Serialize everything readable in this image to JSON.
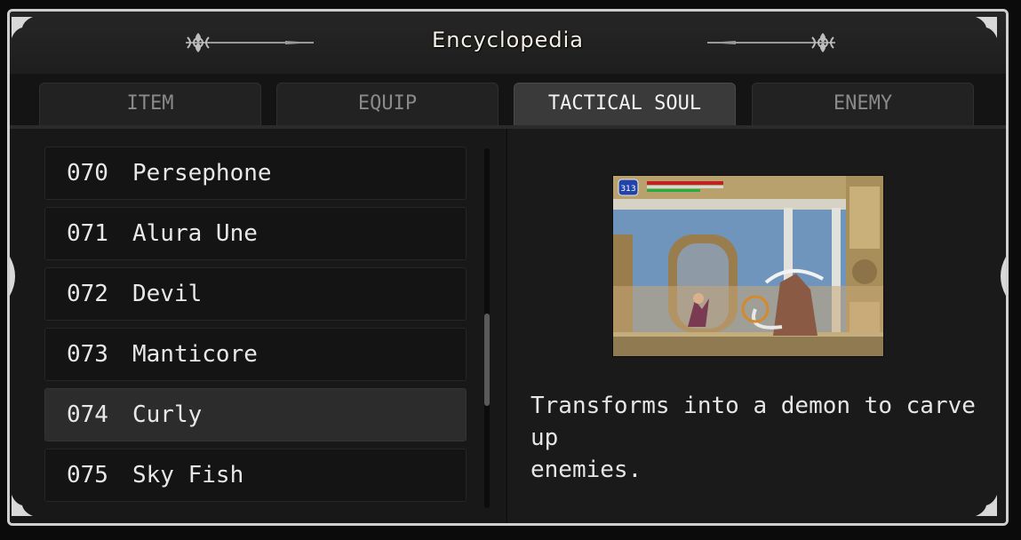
{
  "window": {
    "title": "Encyclopedia"
  },
  "tabs": [
    {
      "label": "ITEM",
      "active": false
    },
    {
      "label": "EQUIP",
      "active": false
    },
    {
      "label": "TACTICAL SOUL",
      "active": true
    },
    {
      "label": "ENEMY",
      "active": false
    }
  ],
  "list": {
    "items": [
      {
        "number": "070",
        "name": "Persephone"
      },
      {
        "number": "071",
        "name": "Alura Une"
      },
      {
        "number": "072",
        "name": "Devil"
      },
      {
        "number": "073",
        "name": "Manticore"
      },
      {
        "number": "074",
        "name": "Curly",
        "selected": true
      },
      {
        "number": "075",
        "name": "Sky Fish"
      }
    ],
    "scroll_position_fraction": 0.46
  },
  "detail": {
    "hud_value": "313",
    "description": "Transforms into a demon to carve up\nenemies."
  },
  "colors": {
    "frame_border": "#cfcfcf",
    "panel_bg": "#1c1c1c",
    "active_tab": "#3a3a3a",
    "selected_row": "#2c2c2c"
  }
}
